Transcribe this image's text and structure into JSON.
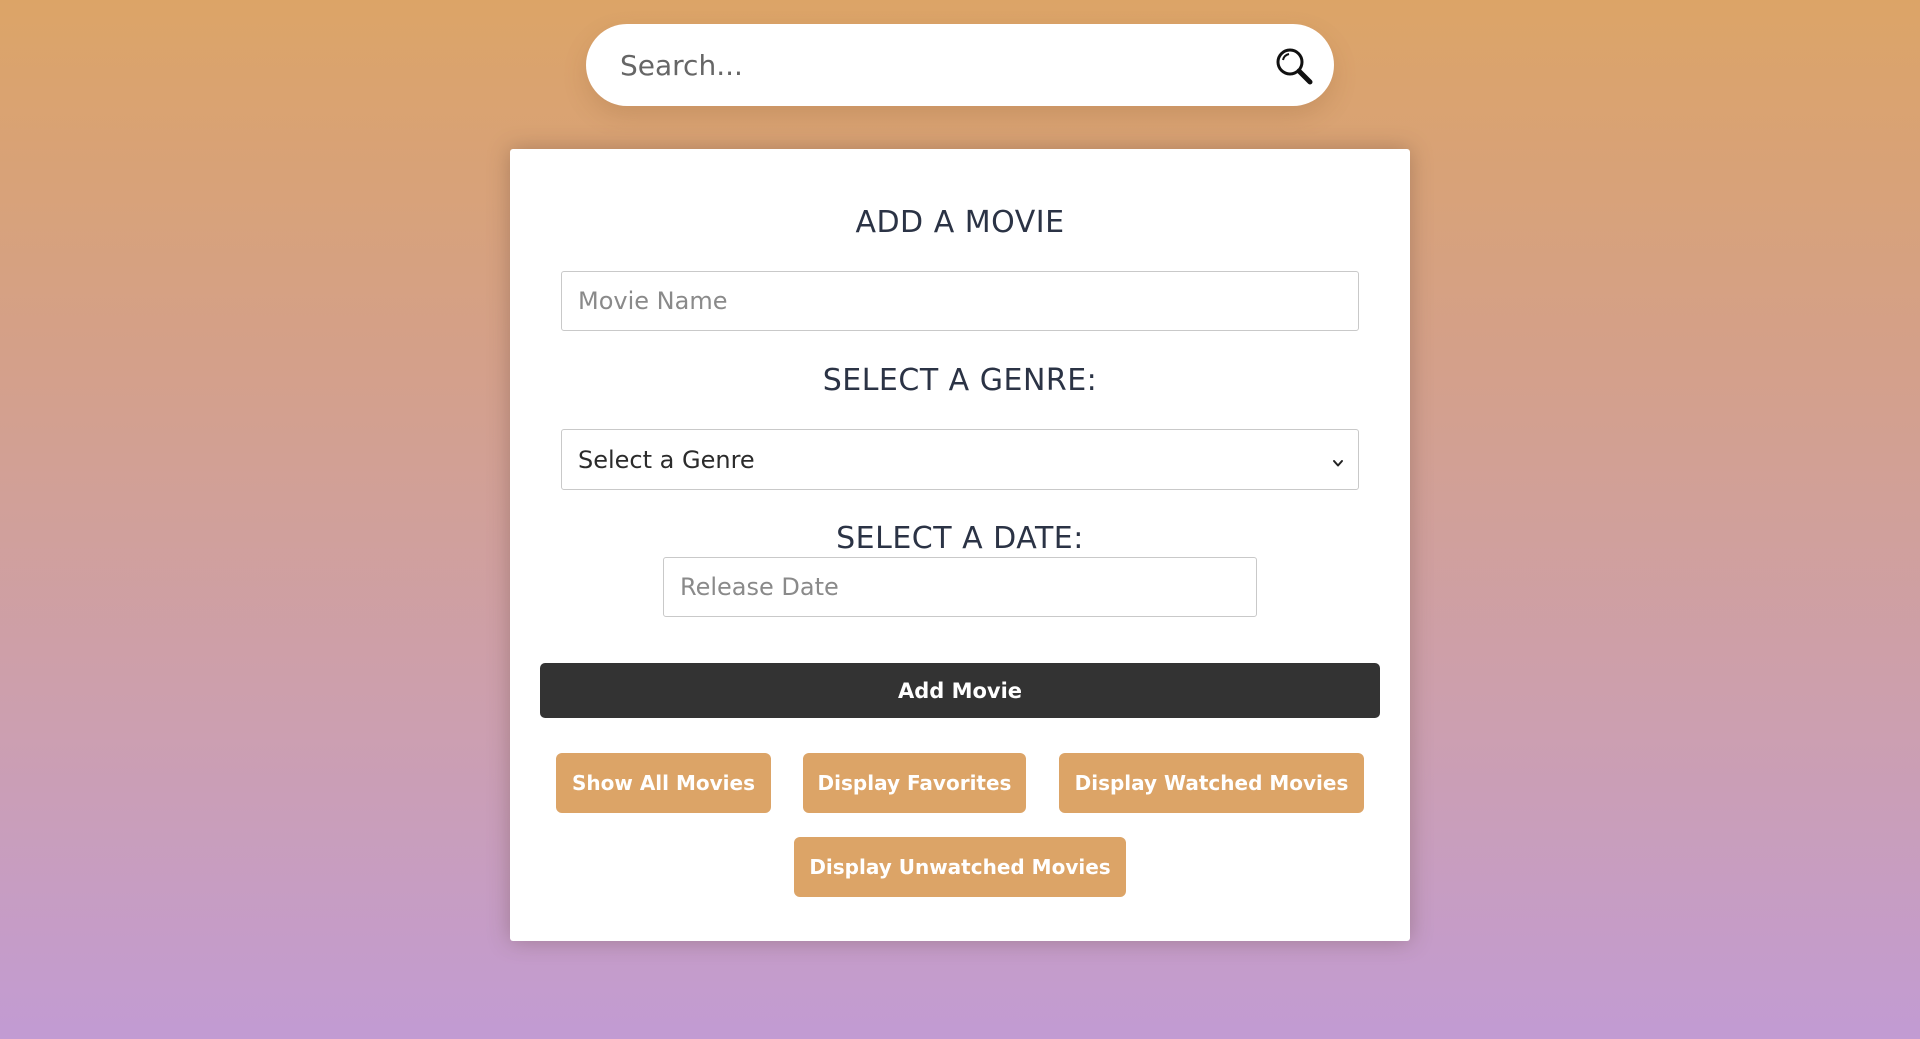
{
  "search": {
    "placeholder": "Search...",
    "icon": "search-icon"
  },
  "form": {
    "title": "ADD A MOVIE",
    "movie_name_placeholder": "Movie Name",
    "genre_heading": "SELECT A GENRE:",
    "genre_selected": "Select a Genre",
    "date_heading": "SELECT A DATE:",
    "release_date_placeholder": "Release Date",
    "add_button_label": "Add Movie"
  },
  "actions": {
    "show_all": "Show All Movies",
    "favorites": "Display Favorites",
    "watched": "Display Watched Movies",
    "unwatched": "Display Unwatched Movies"
  },
  "colors": {
    "accent": "#dca467",
    "dark_button": "#333333",
    "heading_text": "#2b3345"
  }
}
